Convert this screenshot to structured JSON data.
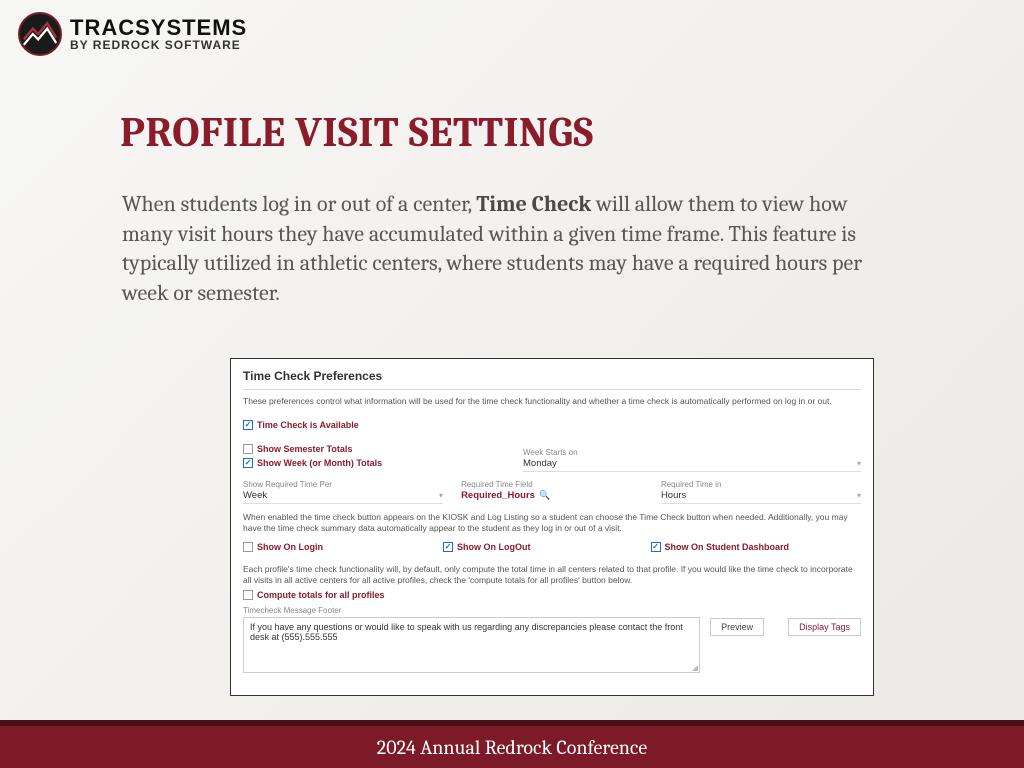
{
  "logo": {
    "main": "TRACSYSTEMS",
    "sub": "BY REDROCK SOFTWARE"
  },
  "slide": {
    "title": "PROFILE VISIT SETTINGS",
    "body_pre": "When students log in or out of a center, ",
    "body_bold": "Time Check",
    "body_post": " will allow them to view how many visit hours they have accumulated within a given time frame. This feature is typically utilized in athletic centers, where students may have a required hours per week or semester."
  },
  "panel": {
    "title": "Time Check Preferences",
    "desc": "These preferences control what information will be used for the time check functionality and whether a time check is automatically performed on log in or out.",
    "cb": {
      "available": "Time Check is Available",
      "semester": "Show Semester Totals",
      "week": "Show Week (or Month) Totals",
      "login": "Show On Login",
      "logout": "Show On LogOut",
      "dashboard": "Show On Student Dashboard",
      "compute": "Compute totals for all profiles"
    },
    "fields": {
      "week_starts_label": "Week Starts on",
      "week_starts_value": "Monday",
      "req_per_label": "Show Required Time Per",
      "req_per_value": "Week",
      "req_field_label": "Required Time Field",
      "req_field_value": "Required_Hours",
      "req_in_label": "Required Time in",
      "req_in_value": "Hours"
    },
    "note1": "When enabled the time check button appears on the KIOSK and Log Listing so a student can choose the Time Check button when needed. Additionally, you may have the time check summary data automatically appear to the student as they log in or out of a visit.",
    "note2": "Each profile's time check functionality will, by default, only compute the total time in all centers related to that profile. If you would like the time check to incorporate all visits in all active centers for all active profiles, check the 'compute totals for all profiles' button below.",
    "msg_label": "Timecheck Message Footer",
    "msg_value": "If you have any questions or would like to speak with us regarding any discrepancies please contact the front desk at (555).555.555",
    "btn_preview": "Preview",
    "btn_tags": "Display Tags"
  },
  "footer": "2024 Annual Redrock Conference"
}
